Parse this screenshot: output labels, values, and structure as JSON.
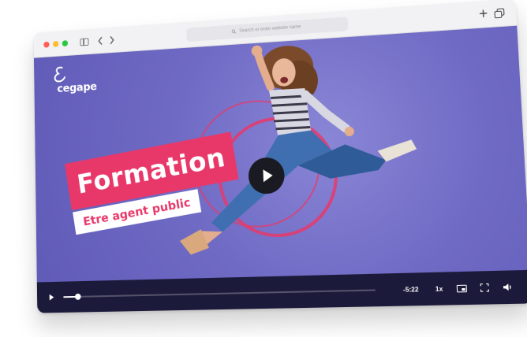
{
  "browser": {
    "address_placeholder": "Search or enter website name",
    "controls": {
      "traffic_colors": [
        "#ff5f57",
        "#febc2e",
        "#28c840"
      ]
    }
  },
  "video": {
    "logo_text": "cegape",
    "title": "Formation",
    "subtitle": "Etre agent public",
    "accent_color": "#e8386a",
    "background_color": "#6f6ac4"
  },
  "player": {
    "time_remaining": "-5:22",
    "speed": "1x",
    "progress_fraction": 0.05
  },
  "icons": {
    "back": "chevron-left-icon",
    "forward": "chevron-right-icon",
    "sidebar": "sidebar-icon",
    "new_tab": "plus-icon",
    "tabs": "tabs-icon",
    "play": "play-icon",
    "pip": "picture-in-picture-icon",
    "fullscreen": "fullscreen-icon",
    "volume": "volume-icon"
  }
}
